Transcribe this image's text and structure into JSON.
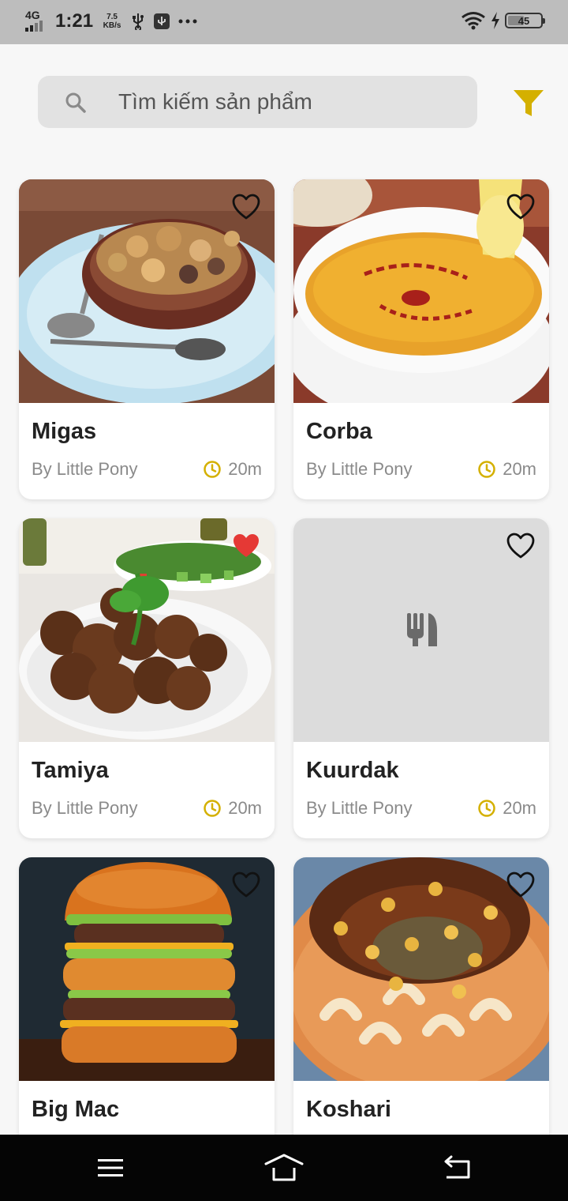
{
  "status_bar": {
    "network": "4G",
    "time": "1:21",
    "speed_value": "7.5",
    "speed_unit": "KB/s",
    "battery": "45"
  },
  "search": {
    "placeholder": "Tìm kiếm sản phẩm",
    "value": ""
  },
  "accent_color": "#d4b000",
  "favorite_active_color": "#e53935",
  "recipes": [
    {
      "name": "Migas",
      "author": "By Little Pony",
      "time": "20m",
      "favorite": false,
      "image": "migas-photo"
    },
    {
      "name": "Corba",
      "author": "By Little Pony",
      "time": "20m",
      "favorite": false,
      "image": "corba-photo"
    },
    {
      "name": "Tamiya",
      "author": "By Little Pony",
      "time": "20m",
      "favorite": true,
      "image": "tamiya-photo"
    },
    {
      "name": "Kuurdak",
      "author": "By Little Pony",
      "time": "20m",
      "favorite": false,
      "image": "placeholder-utensils-icon"
    },
    {
      "name": "Big Mac",
      "author": "",
      "time": "",
      "favorite": false,
      "image": "big-mac-photo"
    },
    {
      "name": "Koshari",
      "author": "",
      "time": "",
      "favorite": false,
      "image": "koshari-photo"
    }
  ]
}
